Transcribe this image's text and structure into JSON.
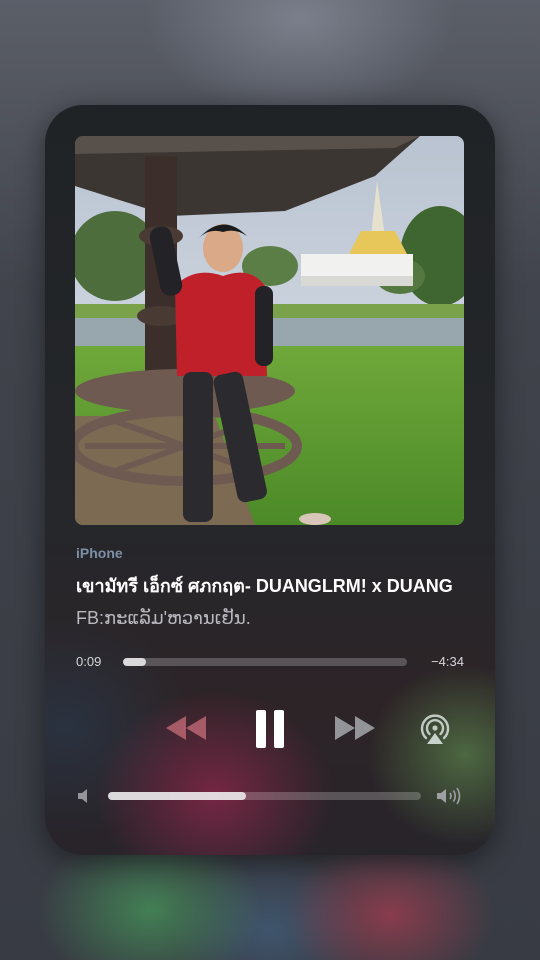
{
  "now_playing": {
    "route_label": "iPhone",
    "song_title": "เขามัทรี เอ็กซ์ ศภกฤต- DUANGLRM! x DUANG",
    "artist": "FB:ກະແລັມ'ຫວານເຢັນ.",
    "artwork_icon": "album-artwork-photo"
  },
  "playback": {
    "elapsed": "0:09",
    "remaining": "−4:34",
    "progress_fraction": 0.03,
    "state": "playing"
  },
  "controls": {
    "rewind_icon": "rewind-icon",
    "pause_icon": "pause-icon",
    "forward_icon": "fast-forward-icon",
    "airplay_icon": "airplay-icon"
  },
  "volume": {
    "level_fraction": 0.44,
    "low_icon": "speaker-low-icon",
    "high_icon": "speaker-high-icon"
  },
  "colors": {
    "accent_label": "#7d8fa6",
    "text_primary": "#ffffff",
    "text_secondary": "#b8b8bf"
  }
}
